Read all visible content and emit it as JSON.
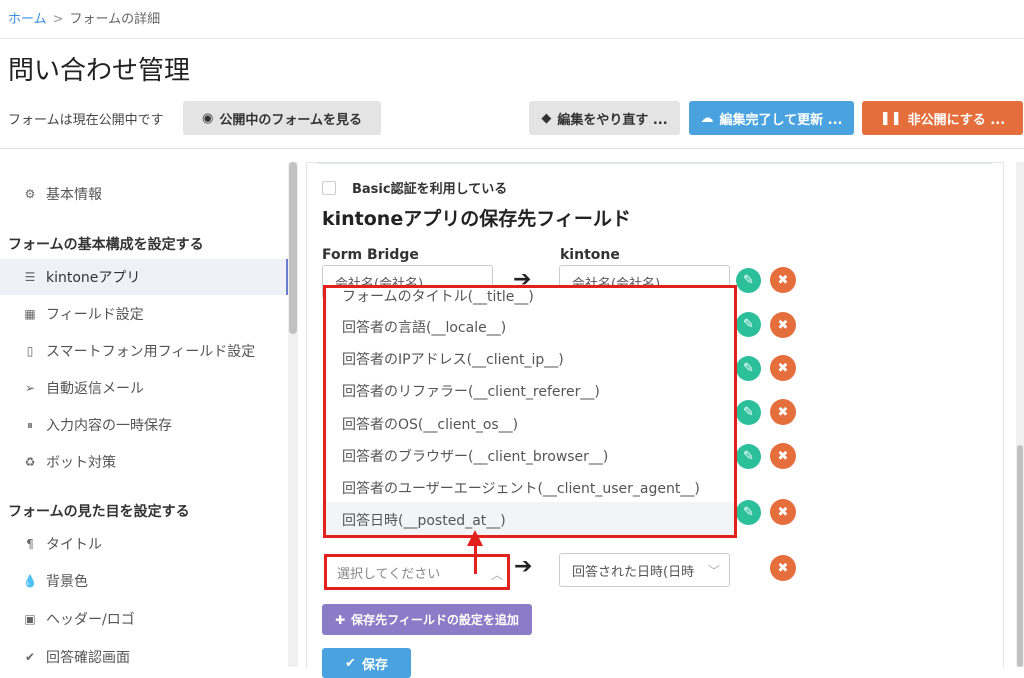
{
  "breadcrumb": {
    "home": "ホーム",
    "separator": ">",
    "current": "フォームの詳細"
  },
  "page_title": "問い合わせ管理",
  "status_text": "フォームは現在公開中です",
  "buttons": {
    "view_form": "公開中のフォームを見る",
    "redo": "編集をやり直す ...",
    "finish_update": "編集完了して更新 ...",
    "unpublish": "非公開にする ..."
  },
  "sidebar": {
    "items": [
      {
        "label": "基本情報",
        "icon": "gear-icon"
      },
      {
        "label": "kintoneアプリ",
        "icon": "database-icon"
      },
      {
        "label": "フィールド設定",
        "icon": "grid-icon"
      },
      {
        "label": "スマートフォン用フィールド設定",
        "icon": "mobile-icon"
      },
      {
        "label": "自動返信メール",
        "icon": "paper-plane-icon"
      },
      {
        "label": "入力内容の一時保存",
        "icon": "pause-icon"
      },
      {
        "label": "ボット対策",
        "icon": "recycle-icon"
      },
      {
        "label": "タイトル",
        "icon": "paragraph-icon"
      },
      {
        "label": "背景色",
        "icon": "tint-icon"
      },
      {
        "label": "ヘッダー/ロゴ",
        "icon": "image-icon"
      },
      {
        "label": "回答確認画面",
        "icon": "check-icon"
      }
    ],
    "section_basic": "フォームの基本構成を設定する",
    "section_look": "フォームの見た目を設定する"
  },
  "main": {
    "basic_auth_label": "Basic認証を利用している",
    "section_title": "kintoneアプリの保存先フィールド",
    "col_formbridge": "Form Bridge",
    "col_kintone": "kintone",
    "row1": {
      "left": "会社名(会社名)",
      "right": "会社名(会社名)"
    },
    "last_row": {
      "left_placeholder": "選択してください",
      "right": "回答された日時(日時"
    },
    "add_button": "保存先フィールドの設定を追加",
    "save_button": "保存"
  },
  "dropdown": {
    "items": [
      "フォームのタイトル(__title__)",
      "回答者の言語(__locale__)",
      "回答者のIPアドレス(__client_ip__)",
      "回答者のリファラー(__client_referer__)",
      "回答者のOS(__client_os__)",
      "回答者のブラウザー(__client_browser__)",
      "回答者のユーザーエージェント(__client_user_agent__)",
      "回答日時(__posted_at__)"
    ],
    "highlighted_index": 7
  },
  "colors": {
    "link": "#3a8ee6",
    "blue_button": "#4aa3df",
    "orange_button": "#e56f3c",
    "teal_edit": "#2bbf9a",
    "purple_add": "#8a7cc6",
    "annotation_red": "#e2211c"
  }
}
